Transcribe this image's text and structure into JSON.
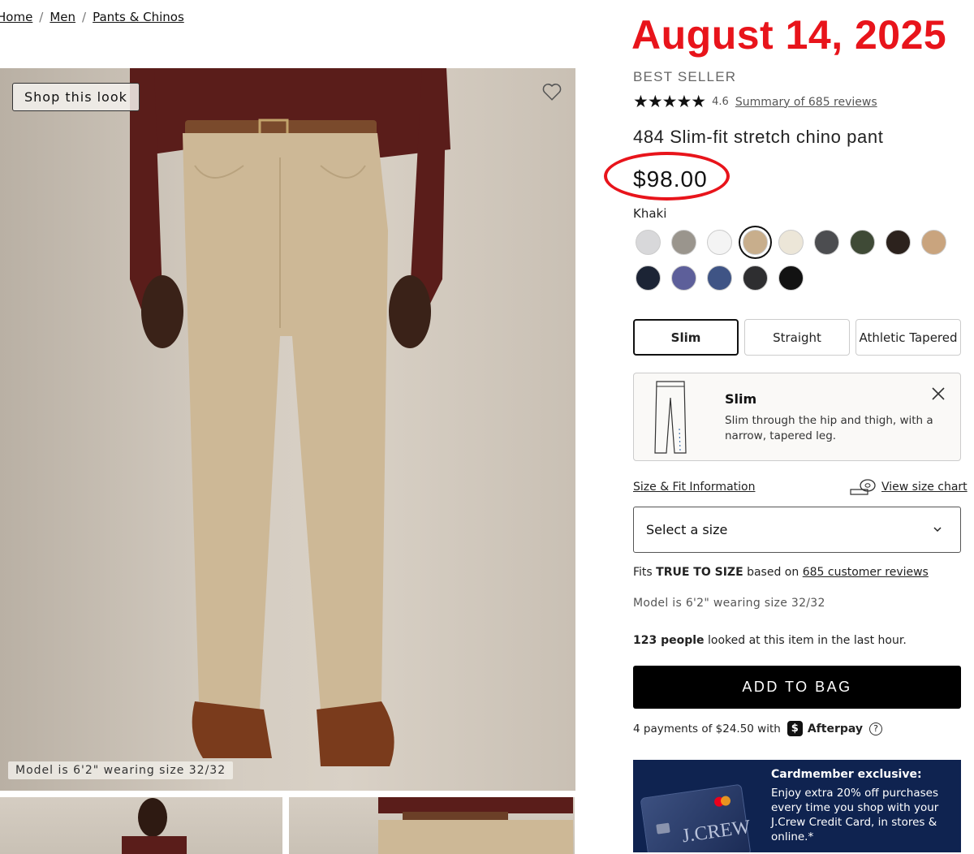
{
  "breadcrumb": {
    "items": [
      "Home",
      "Men",
      "Pants & Chinos"
    ],
    "separator": "/"
  },
  "annotation": {
    "date": "August 14, 2025",
    "color": "#e8141b"
  },
  "gallery": {
    "shop_look_label": "Shop this look",
    "model_caption": "Model is 6'2\" wearing size 32/32",
    "favorite_icon": "heart-icon"
  },
  "product": {
    "badge": "BEST SELLER",
    "rating": "4.6",
    "stars": "★★★★★",
    "reviews_link": "Summary of 685 reviews",
    "title": "484 Slim-fit stretch chino pant",
    "price": "$98.00",
    "selected_color": "Khaki",
    "swatches": [
      {
        "color": "#d8d8da"
      },
      {
        "color": "#9a958d"
      },
      {
        "color": "#f4f4f4"
      },
      {
        "color": "#c8ae8c",
        "selected": true
      },
      {
        "color": "#ece6d8"
      },
      {
        "color": "#4c4d50"
      },
      {
        "color": "#3f4a36"
      },
      {
        "color": "#2c221d"
      },
      {
        "color": "#c9a47e"
      },
      {
        "color": "#1c2435"
      },
      {
        "color": "#5d5f9a"
      },
      {
        "color": "#3f5485"
      },
      {
        "color": "#2e2e30"
      },
      {
        "color": "#121212"
      }
    ]
  },
  "fits": {
    "options": [
      "Slim",
      "Straight",
      "Athletic Tapered"
    ],
    "selected": "Slim",
    "card_title": "Slim",
    "card_desc": "Slim through the hip and thigh, with a narrow, tapered leg."
  },
  "size": {
    "info_link": "Size & Fit Information",
    "chart_link": "View size chart",
    "select_placeholder": "Select a size",
    "fits_prefix": "Fits",
    "fits_value": "TRUE TO SIZE",
    "fits_mid": "based on",
    "fits_link": "685 customer reviews",
    "model_note": "Model is 6'2\" wearing size 32/32",
    "people_count": "123 people",
    "people_suffix": "looked at this item in the last hour."
  },
  "actions": {
    "add_to_bag": "ADD TO BAG",
    "afterpay_text": "4 payments of $24.50 with",
    "afterpay_brand": "Afterpay",
    "info_symbol": "?"
  },
  "promo": {
    "title": "Cardmember exclusive:",
    "body": "Enjoy extra 20% off purchases every time you shop with your J.Crew Credit Card, in stores & online.*",
    "card_brand": "J.CREW"
  }
}
